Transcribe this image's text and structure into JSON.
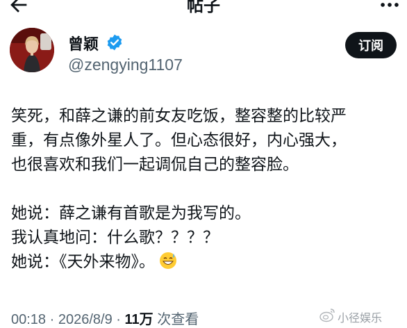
{
  "header": {
    "title": "帖子"
  },
  "user": {
    "name": "曾颖",
    "handle": "@zengying1107"
  },
  "subscribe_button": {
    "label": "订阅"
  },
  "post": {
    "lines": [
      "笑死，和薛之谦的前女友吃饭，整容整的比较严",
      "重，有点像外星人了。但心态很好，内心强大，",
      "也很喜欢和我们一起调侃自己的整容脸。",
      "",
      "她说：薛之谦有首歌是为我写的。",
      "我认真地问：什么歌？？？？",
      "她说：《天外来物》。"
    ],
    "emoji": "grinning-sweat-emoji"
  },
  "meta": {
    "time": "00:18",
    "sep1": " · ",
    "date": "2026/8/9",
    "sep2": " · ",
    "views_count": "11万",
    "views_label": " 次查看"
  },
  "watermark": {
    "text": "小径娱乐"
  },
  "colors": {
    "verified": "#1d9bf0",
    "button_bg": "#0f1419",
    "secondary_text": "#536471"
  },
  "icons": [
    "back-arrow-icon",
    "more-icon",
    "verified-badge-icon",
    "weibo-logo-icon"
  ]
}
